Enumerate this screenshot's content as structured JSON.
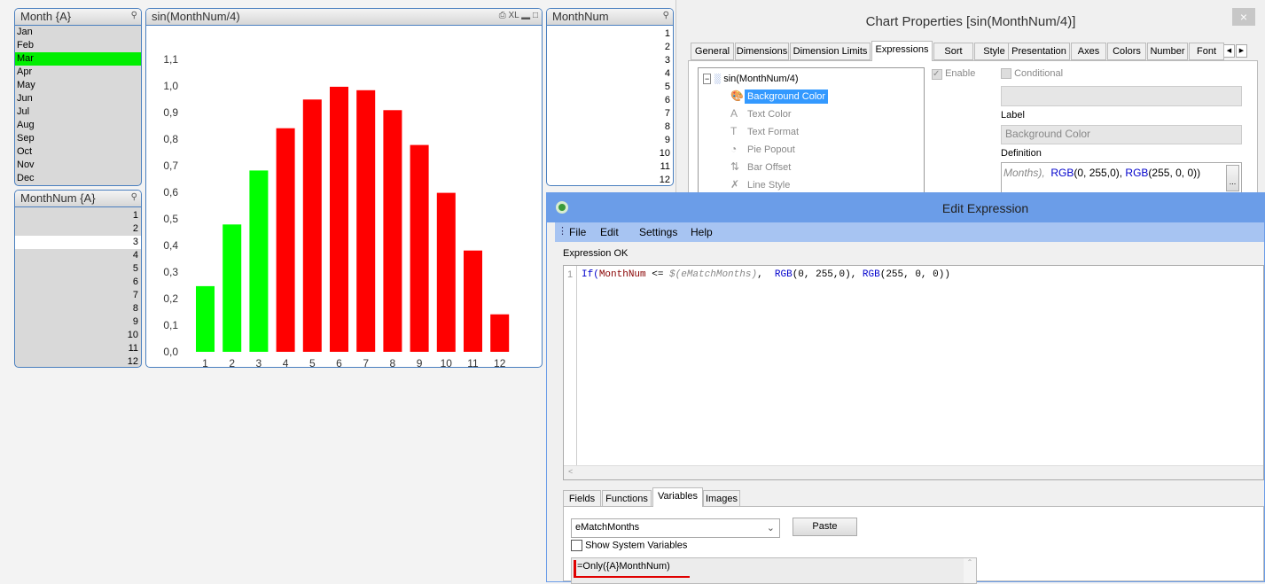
{
  "month_listbox": {
    "title": "Month {A}",
    "items": [
      "Jan",
      "Feb",
      "Mar",
      "Apr",
      "May",
      "Jun",
      "Jul",
      "Aug",
      "Sep",
      "Oct",
      "Nov",
      "Dec"
    ],
    "selected": "Mar"
  },
  "monthnum_a_listbox": {
    "title": "MonthNum {A}",
    "items": [
      "1",
      "2",
      "3",
      "4",
      "5",
      "6",
      "7",
      "8",
      "9",
      "10",
      "11",
      "12"
    ],
    "highlighted": "3"
  },
  "monthnum_listbox": {
    "title": "MonthNum",
    "items": [
      "1",
      "2",
      "3",
      "4",
      "5",
      "6",
      "7",
      "8",
      "9",
      "10",
      "11",
      "12"
    ]
  },
  "chart_window": {
    "title": "sin(MonthNum/4)",
    "icons": [
      "print-icon",
      "xl-icon",
      "minimize-icon",
      "maximize-icon"
    ],
    "xl_label": "XL"
  },
  "chart_data": {
    "type": "bar",
    "title": "sin(MonthNum/4)",
    "categories": [
      "1",
      "2",
      "3",
      "4",
      "5",
      "6",
      "7",
      "8",
      "9",
      "10",
      "11",
      "12"
    ],
    "values": [
      0.247,
      0.479,
      0.682,
      0.841,
      0.949,
      0.997,
      0.984,
      0.909,
      0.778,
      0.598,
      0.381,
      0.141
    ],
    "colors": [
      "#00ff00",
      "#00ff00",
      "#00ff00",
      "#ff0000",
      "#ff0000",
      "#ff0000",
      "#ff0000",
      "#ff0000",
      "#ff0000",
      "#ff0000",
      "#ff0000",
      "#ff0000"
    ],
    "ylim": [
      0,
      1.1
    ],
    "yticks": [
      "0,0",
      "0,1",
      "0,2",
      "0,3",
      "0,4",
      "0,5",
      "0,6",
      "0,7",
      "0,8",
      "0,9",
      "1,0",
      "1,1"
    ],
    "grid": false
  },
  "chart_properties": {
    "title": "Chart Properties [sin(MonthNum/4)]",
    "close": "×",
    "tabs": [
      "General",
      "Dimensions",
      "Dimension Limits",
      "Expressions",
      "Sort",
      "Style",
      "Presentation",
      "Axes",
      "Colors",
      "Number",
      "Font"
    ],
    "active_tab": "Expressions",
    "tree_root": "sin(MonthNum/4)",
    "tree_items": [
      "Background Color",
      "Text Color",
      "Text Format",
      "Pie Popout",
      "Bar Offset",
      "Line Style"
    ],
    "tree_selected": "Background Color",
    "enable_label": "Enable",
    "conditional_label": "Conditional",
    "label_caption": "Label",
    "label_value": "Background Color",
    "definition_caption": "Definition",
    "definition_a": "Months),",
    "definition_b": "RGB",
    "definition_c": "(0, 255,0), ",
    "definition_d": "RGB",
    "definition_e": "(255, 0, 0))",
    "ellipsis": "..."
  },
  "edit_expression": {
    "title": "Edit Expression",
    "menu": [
      "File",
      "Edit",
      "Settings",
      "Help"
    ],
    "status": "Expression OK",
    "line_number": "1",
    "code": {
      "fn": "If(",
      "field": "MonthNum",
      "op": " <= ",
      "var": "$(eMatchMonths)",
      "sep": ",  ",
      "rgb1": "RGB",
      "args1": "(0, 255,0), ",
      "rgb2": "RGB",
      "args2": "(255, 0, 0))"
    },
    "bottom_tabs": [
      "Fields",
      "Functions",
      "Variables",
      "Images"
    ],
    "active_bottom_tab": "Variables",
    "variable_select": "eMatchMonths",
    "paste_label": "Paste",
    "show_system_label": "Show System Variables",
    "variable_definition": "=Only({A}MonthNum)",
    "accent": "#6b9de8"
  }
}
